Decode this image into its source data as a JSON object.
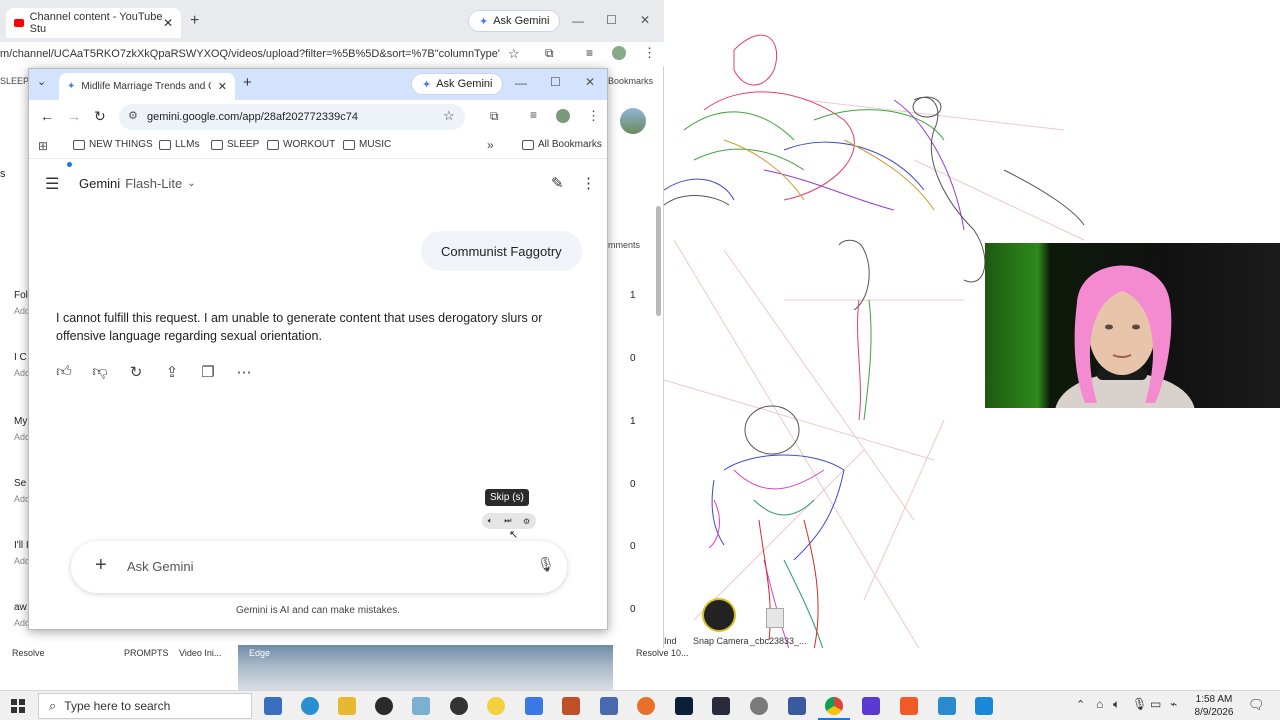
{
  "back_window": {
    "tab_title": "Channel content - YouTube Stu",
    "ask_gemini": "Ask Gemini",
    "url": "m/channel/UCAaT5RKO7zkXkQpaRSWYXOQ/videos/upload?filter=%5B%5D&sort=%7B\"columnType\"%3A...",
    "bookmarks_label": "Bookmarks",
    "sleep_label": "SLEEP",
    "side_letter": "s",
    "comments_label": "mments",
    "rows": [
      {
        "title": "Fol",
        "sub": "Add",
        "count": "1"
      },
      {
        "title": "I C",
        "sub": "Add",
        "count": "0"
      },
      {
        "title": "My",
        "sub": "Add",
        "count": "1"
      },
      {
        "title": "Se",
        "sub": "Add",
        "count": "0"
      },
      {
        "title": "I'll I",
        "sub": "Add",
        "count": "0"
      },
      {
        "title": "aw",
        "sub": "Add",
        "count": "0"
      }
    ]
  },
  "front_window": {
    "tab_title": "Midlife Marriage Trends and Ol",
    "ask_gemini": "Ask Gemini",
    "url": "gemini.google.com/app/28af202772339c74",
    "bookmarks": [
      "NEW THINGS",
      "LLMs",
      "SLEEP",
      "WORKOUT",
      "MUSIC"
    ],
    "all_bookmarks": "All Bookmarks"
  },
  "gemini": {
    "brand": "Gemini",
    "model": "Flash-Lite",
    "user_message": "Communist Faggotry",
    "response": "I cannot fulfill this request. I am unable to generate content that uses derogatory slurs or offensive language regarding sexual orientation.",
    "input_placeholder": "Ask Gemini",
    "disclaimer": "Gemini is AI and can make mistakes."
  },
  "media": {
    "tooltip": "Skip (s)"
  },
  "desktop": {
    "labels": [
      "Resolve",
      "PROMPTS",
      "Video Ini...",
      "Edge",
      "Resolve 10...",
      "Snap Camera",
      "_cbc23833_..."
    ],
    "ind_label": "Ind"
  },
  "taskbar": {
    "search_placeholder": "Type here to search",
    "time": "1:58 AM",
    "date": "8/9/2026"
  },
  "colors": {
    "front_tabbar": "#d3e3fd",
    "back_tabbar": "#e8eaed",
    "taskbar": "#f0f0f0",
    "wig_pink": "#f48ad0",
    "webcam_green": "#2f8a1c"
  }
}
